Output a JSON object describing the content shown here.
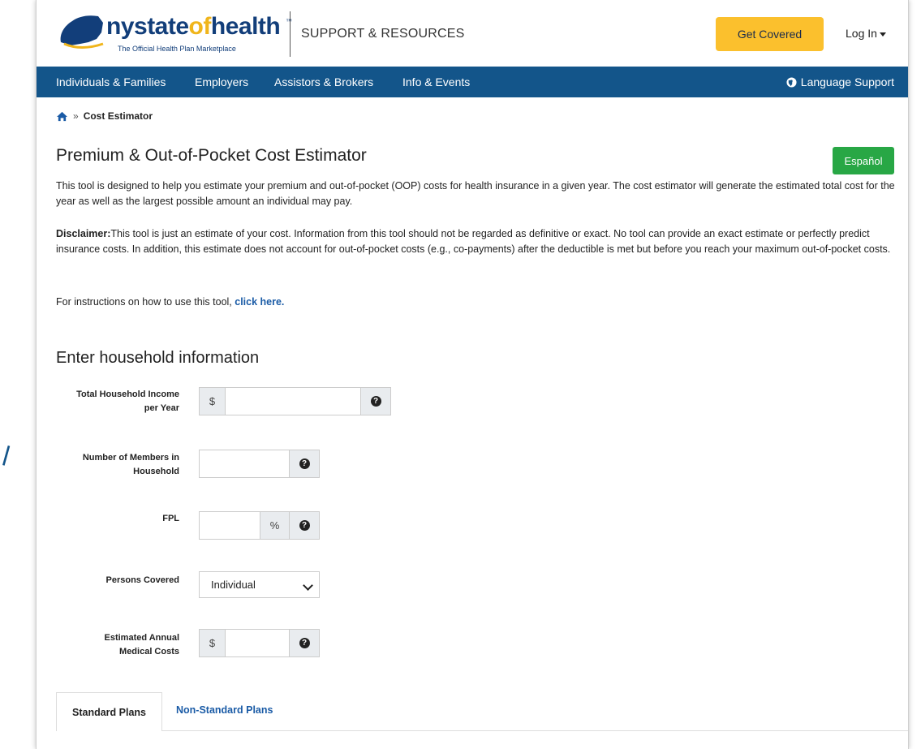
{
  "header": {
    "logo_text_a": "nystate",
    "logo_text_b": "of",
    "logo_text_c": "health",
    "logo_tagline": "The Official Health Plan Marketplace",
    "support_title": "SUPPORT & RESOURCES",
    "get_covered": "Get Covered",
    "login": "Log In"
  },
  "nav": {
    "items": [
      "Individuals & Families",
      "Employers",
      "Assistors & Brokers",
      "Info & Events"
    ],
    "language": "Language Support"
  },
  "breadcrumb": {
    "separator": "»",
    "current": "Cost Estimator"
  },
  "main": {
    "title": "Premium & Out-of-Pocket Cost Estimator",
    "espanol": "Español",
    "intro": "This tool is designed to help you estimate your premium and out-of-pocket (OOP) costs for health insurance in a given year. The cost estimator will generate the estimated total cost for the year as well as the largest possible amount an individual may pay.",
    "disclaimer_label": "Disclaimer:",
    "disclaimer": "This tool is just an estimate of your cost. Information from this tool should not be regarded as definitive or exact. No tool can provide an exact estimate or perfectly predict insurance costs. In addition, this estimate does not account for out-of-pocket costs (e.g., co-payments) after the deductible is met but before you reach your maximum out-of-pocket costs.",
    "instructions": "For instructions on how to use this tool, ",
    "instructions_link": "click here."
  },
  "form": {
    "heading": "Enter household information",
    "income_label_1": "Total Household Income",
    "income_label_2": "per Year",
    "income_prefix": "$",
    "income_value": "",
    "members_label_1": "Number of Members in",
    "members_label_2": "Household",
    "members_value": "",
    "fpl_label": "FPL",
    "fpl_suffix": "%",
    "fpl_value": "",
    "persons_label": "Persons Covered",
    "persons_selected": "Individual",
    "medical_label_1": "Estimated Annual",
    "medical_label_2": "Medical Costs",
    "medical_prefix": "$",
    "medical_value": "",
    "help_glyph": "?"
  },
  "tabs": {
    "active": "Standard Plans",
    "other": "Non-Standard Plans"
  },
  "colors": {
    "nav_blue": "#13558a",
    "accent_yellow": "#fbc02d",
    "green": "#28a745",
    "link_blue": "#1a5ba6"
  }
}
